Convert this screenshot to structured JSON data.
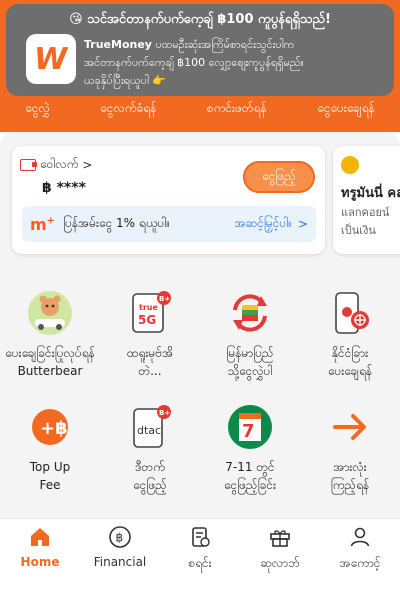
{
  "notification": {
    "title": "😘 သင်အင်တာနက်ပက်ကေ့ချ် ฿100 ကူပွန်ရရှိသည်!",
    "brand": "TrueMoney",
    "body_line1": " ပထမဦးဆုံးအကြိမ်စာရင်းသွင်းပါက",
    "body_line2": "အင်တာနက်ပက်ကေ့ချ် ฿100 လျှော့စျေးကူပွန်ရရှိမည်။",
    "body_line3": "ယခုနှိပ်ပြီးရယူပါ  👉"
  },
  "tabs": [
    "ငွေလွှဲ",
    "ငွေလက်ခံရန်",
    "စကင်းဖတ်ရန်",
    "ငွေပေးချေရန်"
  ],
  "wallet": {
    "label": "ဝေါလက်",
    "chevron": ">",
    "balance": "฿ ****",
    "topup_label": "ငွေဖြည့်"
  },
  "promo": {
    "logo": "m",
    "text": "ပြန်အမ်းငွေ 1% ရယူပါ။",
    "link": "အဆင့်မြှင့်ပါ။",
    "arrow": ">"
  },
  "side_card": {
    "title": "ทรูมันนี่ คล",
    "sub1": "แลกคอยน์",
    "sub2": "เป็นเงิน"
  },
  "services": [
    {
      "label": "ပေးချေခြင်း ▸ Butterbear",
      "line1": "ပေးချေခြင်းပြုလုပ်ရန်",
      "line2": "Butterbear",
      "icon": "butterbear-icon"
    },
    {
      "label": "true 5G",
      "line1": "ထရူးမုဗ်အိ",
      "line2": "တဲ...",
      "icon": "true-5g-icon"
    },
    {
      "label": "မြန်မာပြည်",
      "line1": "မြန်မာပြည်",
      "line2": "သို့ငွေလွှဲပါ",
      "icon": "myanmar-transfer-icon"
    },
    {
      "label": "နိုင်ငံခြား",
      "line1": "နိုင်ငံခြား",
      "line2": "ပေးချေရန်",
      "icon": "overseas-pay-icon"
    },
    {
      "label": "Top Up Fee",
      "line1": "Top Up",
      "line2": "Fee",
      "icon": "topup-fee-icon"
    },
    {
      "label": "dtac",
      "line1": "ဒီတက်",
      "line2": "ငွေဖြည့်",
      "icon": "dtac-icon"
    },
    {
      "label": "7-11",
      "line1": "7-11 တွင်",
      "line2": "ငွေဖြည့်ခြင်း",
      "icon": "seven-eleven-icon"
    },
    {
      "label": "အားလုံး",
      "line1": "အားလုံး",
      "line2": "ကြည့်ရန်",
      "icon": "arrow-right-icon"
    }
  ],
  "bottom_nav": [
    {
      "label": "Home",
      "icon": "home-icon",
      "active": true
    },
    {
      "label": "Financial",
      "icon": "baht-icon",
      "active": false
    },
    {
      "label": "စရင်း",
      "icon": "receipt-icon",
      "active": false
    },
    {
      "label": "ဆုလာဘ်",
      "icon": "gift-icon",
      "active": false
    },
    {
      "label": "အကောင့်",
      "icon": "person-icon",
      "active": false
    }
  ],
  "colors": {
    "brand_orange": "#f26a22",
    "notification_bg": "#6e6e6e",
    "link_blue": "#1a73e8"
  }
}
